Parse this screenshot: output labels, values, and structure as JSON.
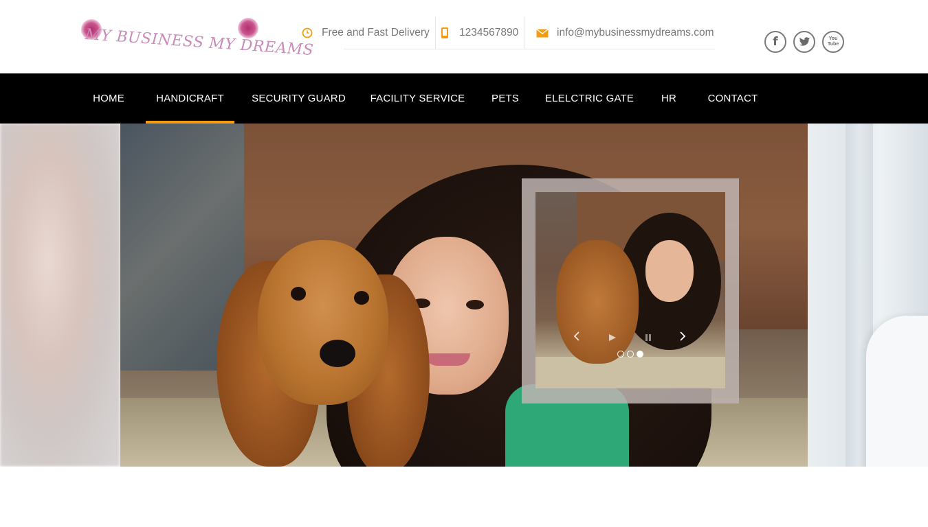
{
  "header": {
    "logo_text": "MY BUSINESS MY DREAMS",
    "delivery_text": "Free and Fast Delivery",
    "phone": "1234567890",
    "email": "info@mybusinessmydreams.com",
    "socials": [
      {
        "label": "f",
        "icon": "facebook-icon"
      },
      {
        "label": "t",
        "icon": "twitter-icon"
      },
      {
        "label": "You Tube",
        "icon": "youtube-icon"
      }
    ],
    "accent_color": "#f39c12"
  },
  "nav": {
    "items": [
      {
        "label": "HOME",
        "active": false
      },
      {
        "label": "HANDICRAFT",
        "active": true
      },
      {
        "label": "SECURITY GUARD",
        "active": false
      },
      {
        "label": "FACILITY SERVICE",
        "active": false
      },
      {
        "label": "PETS",
        "active": false
      },
      {
        "label": "ELELCTRIC GATE",
        "active": false
      },
      {
        "label": "HR",
        "active": false
      },
      {
        "label": "CONTACT",
        "active": false
      }
    ]
  },
  "slider": {
    "slide_count": 3,
    "active_slide": 3
  }
}
